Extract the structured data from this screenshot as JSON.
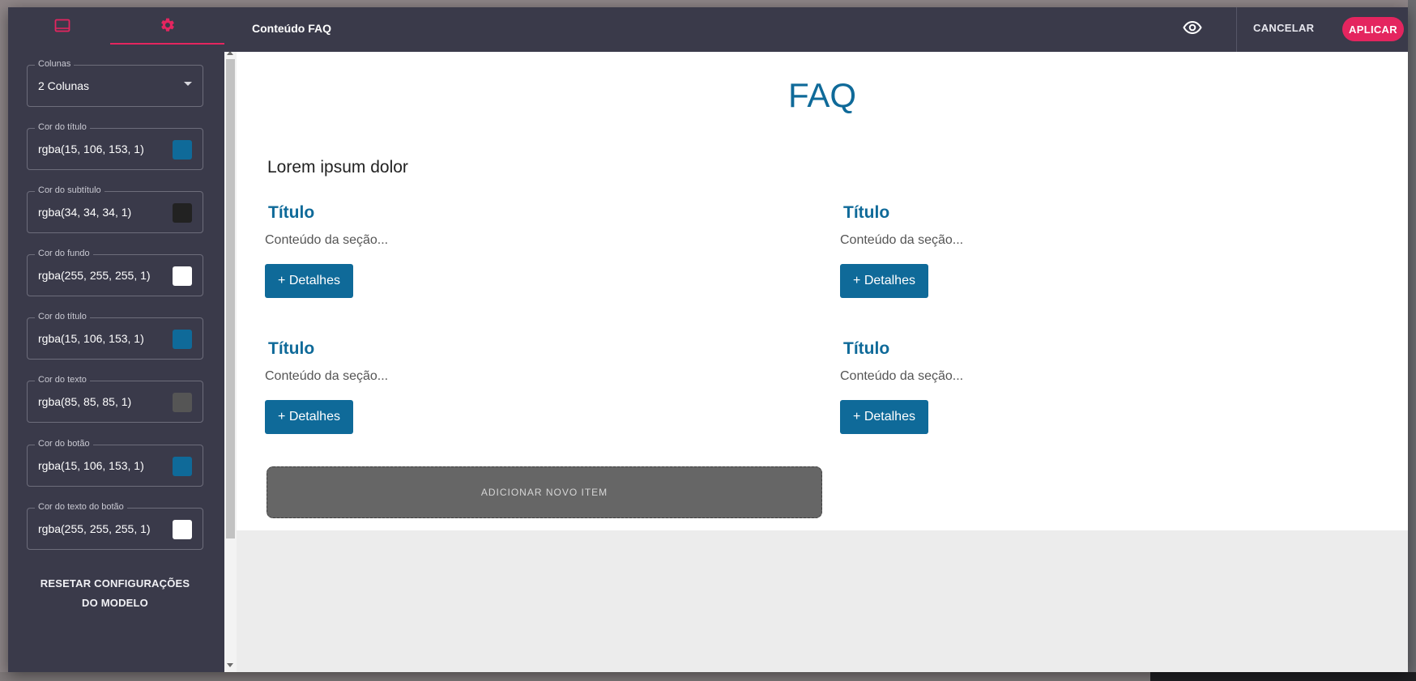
{
  "colors": {
    "accent": "#e4255f",
    "panel": "#3a3a4a",
    "title": "#0f6a99",
    "subtitle": "#222222",
    "background": "#ffffff",
    "text": "#555555",
    "button": "#0f6a99",
    "button_text": "#ffffff"
  },
  "sidebar": {
    "tabs": [
      {
        "icon": "monitor-icon"
      },
      {
        "icon": "gear-icon",
        "active": true
      }
    ],
    "fields": [
      {
        "label": "Colunas",
        "value": "2 Colunas",
        "type": "select"
      },
      {
        "label": "Cor do título",
        "value": "rgba(15, 106, 153, 1)",
        "swatch": "#0f6a99"
      },
      {
        "label": "Cor do subtítulo",
        "value": "rgba(34, 34, 34, 1)",
        "swatch": "#222222"
      },
      {
        "label": "Cor do fundo",
        "value": "rgba(255, 255, 255, 1)",
        "swatch": "#ffffff"
      },
      {
        "label": "Cor do título",
        "value": "rgba(15, 106, 153, 1)",
        "swatch": "#0f6a99"
      },
      {
        "label": "Cor do texto",
        "value": "rgba(85, 85, 85, 1)",
        "swatch": "#555555"
      },
      {
        "label": "Cor do botão",
        "value": "rgba(15, 106, 153, 1)",
        "swatch": "#0f6a99"
      },
      {
        "label": "Cor do texto do botão",
        "value": "rgba(255, 255, 255, 1)",
        "swatch": "#ffffff"
      }
    ],
    "reset_label_line1": "RESETAR CONFIGURAÇÕES",
    "reset_label_line2": "DO MODELO"
  },
  "header": {
    "title": "Conteúdo FAQ",
    "preview_icon": "eye-icon",
    "cancel_label": "CANCELAR",
    "apply_label": "APLICAR"
  },
  "canvas": {
    "title": "FAQ",
    "subtitle": "Lorem ipsum dolor",
    "items": [
      {
        "title": "Título",
        "text": "Conteúdo da seção...",
        "button": "+ Detalhes"
      },
      {
        "title": "Título",
        "text": "Conteúdo da seção...",
        "button": "+ Detalhes"
      },
      {
        "title": "Título",
        "text": "Conteúdo da seção...",
        "button": "+ Detalhes"
      },
      {
        "title": "Título",
        "text": "Conteúdo da seção...",
        "button": "+ Detalhes"
      }
    ],
    "add_item_label": "ADICIONAR NOVO ITEM"
  }
}
